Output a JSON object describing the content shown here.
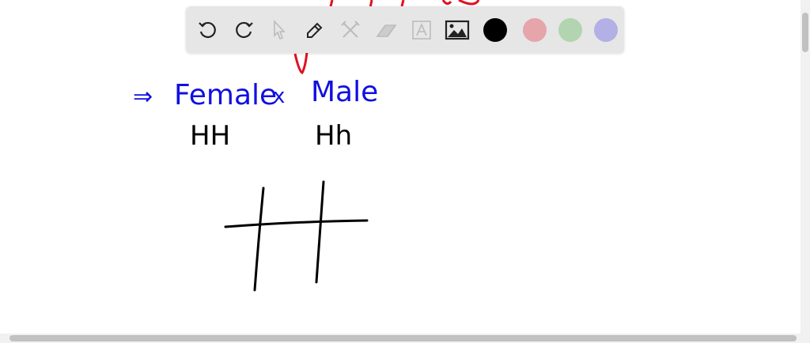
{
  "toolbar": {
    "tools": [
      "undo-icon",
      "redo-icon",
      "select-icon",
      "pen-icon",
      "tools-icon",
      "eraser-icon",
      "text-icon",
      "image-icon"
    ],
    "colors": [
      "#000000",
      "#e6a5ab",
      "#b2d4b0",
      "#b3b0e6"
    ]
  },
  "drawing": {
    "arrow": "⇒",
    "female": "Female",
    "cross": "x",
    "male": "Male",
    "female_genotype": "HH",
    "male_genotype": "Hh",
    "ink_blue": "#1010e0",
    "ink_red": "#e01020",
    "ink_black": "#000000"
  }
}
